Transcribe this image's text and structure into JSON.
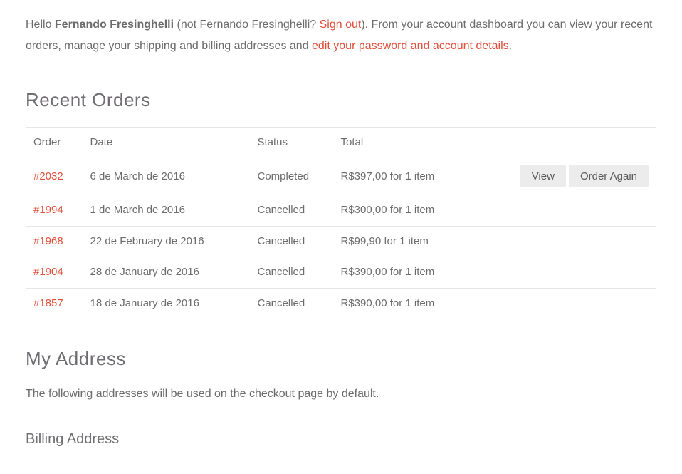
{
  "welcome": {
    "hello": "Hello ",
    "name": "Fernando Fresinghelli",
    "not_prefix": " (not Fernando Fresinghelli? ",
    "signout": "Sign out",
    "not_suffix": "). From your account dashboard you can view your recent orders, manage your shipping and billing addresses and ",
    "edit_details": "edit your password and account details",
    "period": "."
  },
  "headings": {
    "recent_orders": "Recent Orders",
    "my_address": "My Address",
    "billing_address": "Billing Address"
  },
  "orders_table": {
    "headers": {
      "order": "Order",
      "date": "Date",
      "status": "Status",
      "total": "Total"
    },
    "rows": [
      {
        "order": "#2032",
        "date": "6 de March de 2016",
        "status": "Completed",
        "total": "R$397,00 for 1 item",
        "view": "View",
        "again": "Order Again",
        "has_actions": true
      },
      {
        "order": "#1994",
        "date": "1 de March de 2016",
        "status": "Cancelled",
        "total": "R$300,00 for 1 item",
        "has_actions": false
      },
      {
        "order": "#1968",
        "date": "22 de February de 2016",
        "status": "Cancelled",
        "total": "R$99,90 for 1 item",
        "has_actions": false
      },
      {
        "order": "#1904",
        "date": "28 de January de 2016",
        "status": "Cancelled",
        "total": "R$390,00 for 1 item",
        "has_actions": false
      },
      {
        "order": "#1857",
        "date": "18 de January de 2016",
        "status": "Cancelled",
        "total": "R$390,00 for 1 item",
        "has_actions": false
      }
    ]
  },
  "address_intro": "The following addresses will be used on the checkout page by default."
}
